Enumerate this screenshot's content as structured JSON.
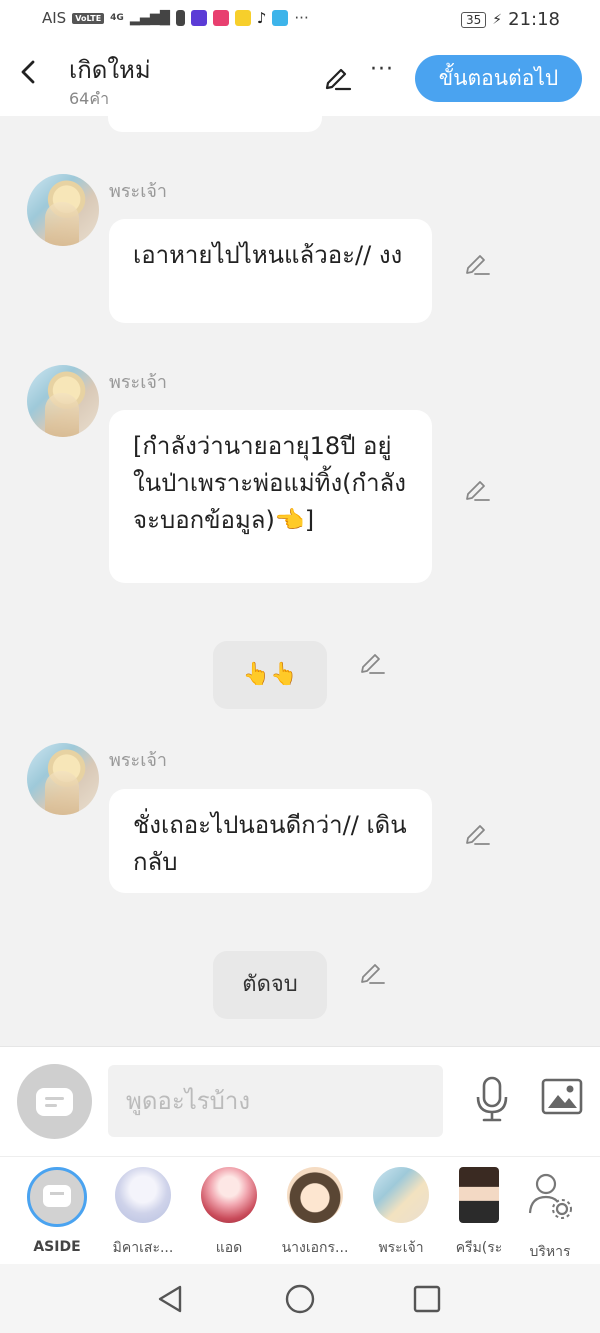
{
  "status_bar": {
    "carrier": "AIS",
    "network": "VoLTE",
    "signal": "4G",
    "battery": "35",
    "time": "21:18",
    "more": "···"
  },
  "header": {
    "title": "เกิดใหม่",
    "word_count": "64คำ",
    "next_label": "ขั้นตอนต่อไป",
    "more_label": "···"
  },
  "messages": [
    {
      "sender": "พระเจ้า",
      "text": "เอาหายไปไหนแล้วอะ// งง"
    },
    {
      "sender": "พระเจ้า",
      "text": "[กำลังว่านายอายุ18ปี อยู่ในป่าเพราะพ่อแม่ทิ้ง(กำลังจะบอกข้อมูล)👈]"
    },
    {
      "center_text": "👆👆"
    },
    {
      "sender": "พระเจ้า",
      "text": "ชั่งเถอะไปนอนดีกว่า// เดินกลับ"
    },
    {
      "center_text": "ตัดจบ"
    }
  ],
  "input": {
    "placeholder": "พูดอะไรบ้าง"
  },
  "characters": [
    {
      "name": "ASIDE"
    },
    {
      "name": "มิคาเสะ..."
    },
    {
      "name": "แอด"
    },
    {
      "name": "นางเอกร..."
    },
    {
      "name": "พระเจ้า"
    },
    {
      "name": "ครีม(ระ"
    },
    {
      "name": "บริหาร"
    }
  ],
  "colors": {
    "accent": "#4aa3f0",
    "chat_bg": "#f2f2f2",
    "bubble": "#ffffff",
    "center_bubble": "#e8e8e8"
  }
}
